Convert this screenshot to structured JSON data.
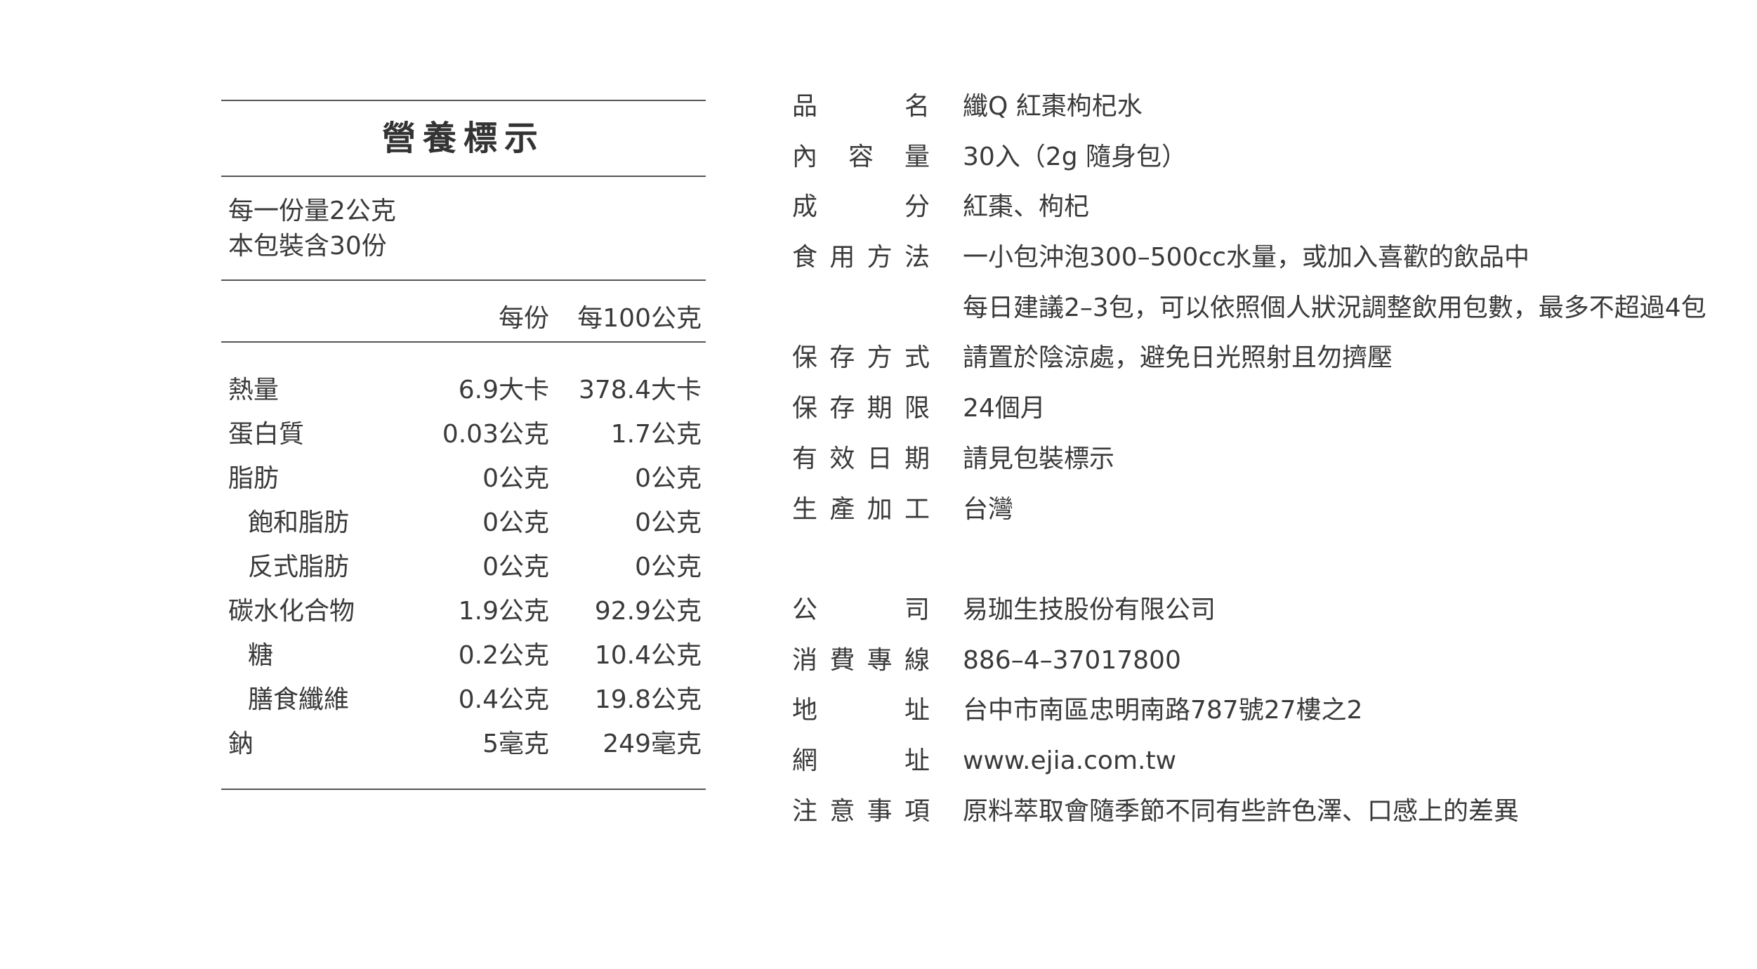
{
  "nutrition": {
    "title": "營養標示",
    "serving_size": "每一份量2公克",
    "servings_per_package": "本包裝含30份",
    "column_headers": [
      "每份",
      "每100公克"
    ],
    "rows": [
      {
        "label": "熱量",
        "per_serving": "6.9大卡",
        "per_100g": "378.4大卡",
        "sub": false
      },
      {
        "label": "蛋白質",
        "per_serving": "0.03公克",
        "per_100g": "1.7公克",
        "sub": false
      },
      {
        "label": "脂肪",
        "per_serving": "0公克",
        "per_100g": "0公克",
        "sub": false
      },
      {
        "label": "飽和脂肪",
        "per_serving": "0公克",
        "per_100g": "0公克",
        "sub": true
      },
      {
        "label": "反式脂肪",
        "per_serving": "0公克",
        "per_100g": "0公克",
        "sub": true
      },
      {
        "label": "碳水化合物",
        "per_serving": "1.9公克",
        "per_100g": "92.9公克",
        "sub": false
      },
      {
        "label": "糖",
        "per_serving": "0.2公克",
        "per_100g": "10.4公克",
        "sub": true
      },
      {
        "label": "膳食纖維",
        "per_serving": "0.4公克",
        "per_100g": "19.8公克",
        "sub": true
      },
      {
        "label": "鈉",
        "per_serving": "5毫克",
        "per_100g": "249毫克",
        "sub": false
      }
    ]
  },
  "info": {
    "rows": [
      {
        "label": [
          "品",
          "名"
        ],
        "value": "纖Q 紅棗枸杞水"
      },
      {
        "label": [
          "內",
          "容",
          "量"
        ],
        "value": "30入（2g 隨身包）"
      },
      {
        "label": [
          "成",
          "分"
        ],
        "value": "紅棗、枸杞"
      },
      {
        "label": [
          "食",
          "用",
          "方",
          "法"
        ],
        "value": "一小包沖泡300–500cc水量，或加入喜歡的飲品中"
      },
      {
        "label": [],
        "value": "每日建議2–3包，可以依照個人狀況調整飲用包數，最多不超過4包"
      },
      {
        "label": [
          "保",
          "存",
          "方",
          "式"
        ],
        "value": "請置於陰涼處，避免日光照射且勿擠壓"
      },
      {
        "label": [
          "保",
          "存",
          "期",
          "限"
        ],
        "value": "24個月"
      },
      {
        "label": [
          "有",
          "效",
          "日",
          "期"
        ],
        "value": "請見包裝標示"
      },
      {
        "label": [
          "生",
          "產",
          "加",
          "工"
        ],
        "value": "台灣"
      },
      {
        "label": null,
        "value": ""
      },
      {
        "label": [
          "公",
          "司"
        ],
        "value": "易珈生技股份有限公司"
      },
      {
        "label": [
          "消",
          "費",
          "專",
          "線"
        ],
        "value": "886–4–37017800"
      },
      {
        "label": [
          "地",
          "址"
        ],
        "value": "台中市南區忠明南路787號27樓之2"
      },
      {
        "label": [
          "網",
          "址"
        ],
        "value": "www.ejia.com.tw"
      },
      {
        "label": [
          "注",
          "意",
          "事",
          "項"
        ],
        "value": "原料萃取會隨季節不同有些許色澤、口感上的差異"
      }
    ]
  }
}
